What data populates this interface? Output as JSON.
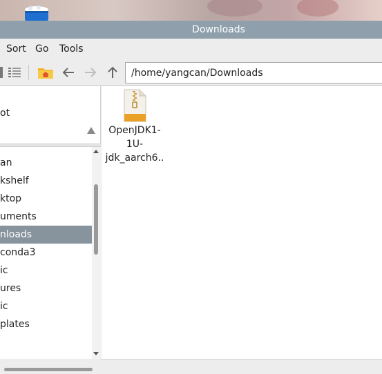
{
  "window": {
    "title": "Downloads"
  },
  "menu": {
    "items": [
      "Sort",
      "Go",
      "Tools"
    ]
  },
  "toolbar": {
    "path_value": "/home/yangcan/Downloads"
  },
  "places": {
    "item_label": "ot"
  },
  "tree": {
    "items": [
      {
        "label": "an",
        "selected": false
      },
      {
        "label": "kshelf",
        "selected": false
      },
      {
        "label": "ktop",
        "selected": false
      },
      {
        "label": "uments",
        "selected": false
      },
      {
        "label": "nloads",
        "selected": true
      },
      {
        "label": "conda3",
        "selected": false
      },
      {
        "label": "ic",
        "selected": false
      },
      {
        "label": "ures",
        "selected": false
      },
      {
        "label": "ic",
        "selected": false
      },
      {
        "label": "plates",
        "selected": false
      }
    ]
  },
  "files": [
    {
      "name_lines": [
        "OpenJDK1-",
        "1U-",
        "jdk_aarch6.."
      ],
      "icon": "archive-icon"
    }
  ],
  "colors": {
    "titlebar": "#8fa0ac",
    "selection": "#87939d",
    "accent_folder": "#f0b429",
    "home_icon": "#e0522b"
  }
}
